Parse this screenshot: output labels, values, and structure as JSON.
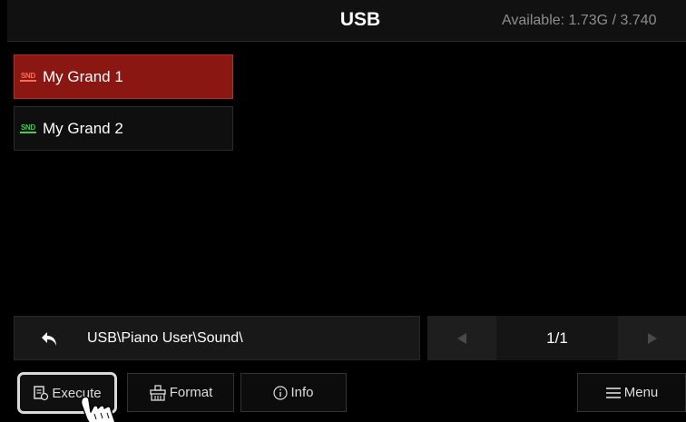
{
  "header": {
    "title": "USB",
    "available": "Available: 1.73G / 3.740"
  },
  "files": [
    {
      "name": "My Grand 1",
      "type": "SND",
      "selected": true
    },
    {
      "name": "My Grand 2",
      "type": "SND",
      "selected": false
    }
  ],
  "path": {
    "text": "USB\\Piano User\\Sound\\"
  },
  "pager": {
    "page": "1/1"
  },
  "toolbar": {
    "execute": "Execute",
    "format": "Format",
    "info": "Info",
    "menu": "Menu"
  },
  "colors": {
    "selected": "#8a1712",
    "snd_selected": "#ff6b5b",
    "snd_normal": "#3fd14a"
  },
  "icons": {
    "back": "back-arrow-icon",
    "prev": "left-triangle-icon",
    "next": "right-triangle-icon",
    "execute": "execute-icon",
    "format": "format-icon",
    "info": "info-circle-icon",
    "menu": "hamburger-icon"
  }
}
